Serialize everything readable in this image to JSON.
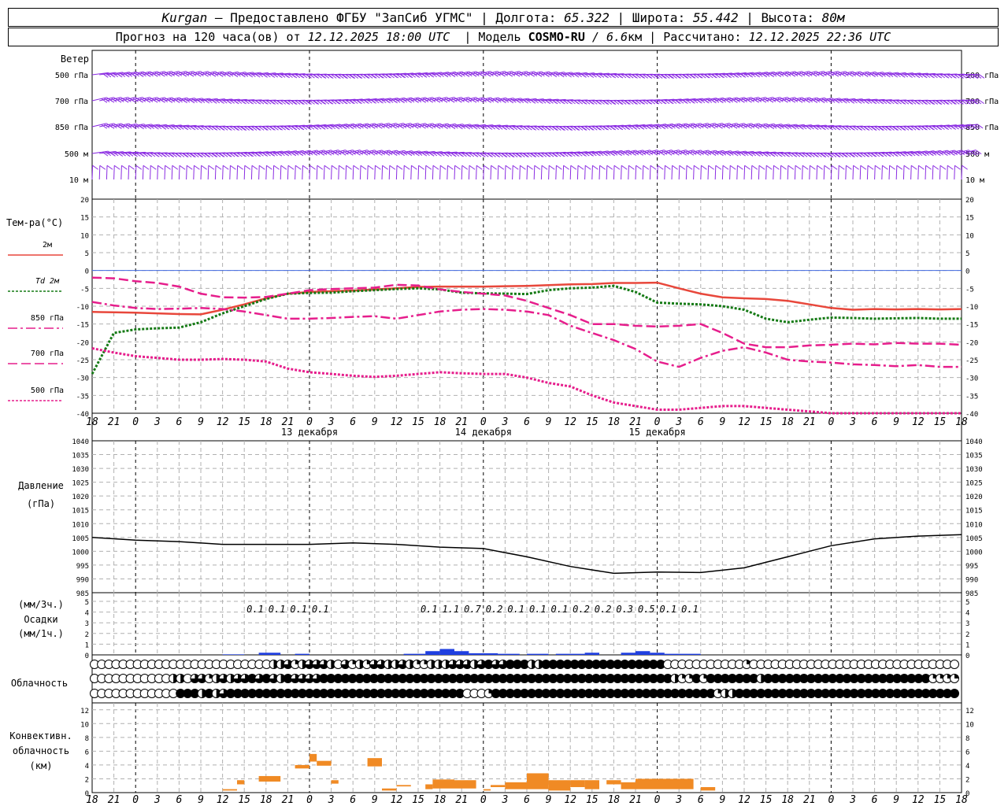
{
  "header": {
    "station": "Kurgan",
    "dash": " — ",
    "provider": "Предоставлено ФГБУ \"ЗапСиб УГМС\"",
    "sep": " | ",
    "lon_label": "Долгота: ",
    "lon": "65.322",
    "lat_label": "Широта: ",
    "lat": "55.442",
    "alt_label": "Высота: ",
    "alt": "80м",
    "forecast_pre": "Прогноз на 120 часа(ов) от ",
    "forecast_time": "12.12.2025 18:00 UTC",
    "model_label": "  | Модель ",
    "model": "COSMO-RU",
    "model_res": " / 6.6",
    "model_res_unit": "км",
    "calc_label": " | Рассчитано: ",
    "calc_time": "12.12.2025 22:36 UTC"
  },
  "colors": {
    "t2m": "#e8473b",
    "td2m": "#157a15",
    "t850": "#e61e8c",
    "t700": "#e61e8c",
    "t500": "#e61e8c",
    "wind": "#8a2be2",
    "precip": "#1f3fe0",
    "convective": "#f08a24",
    "pressure": "#000000",
    "zero_line": "#4169e1",
    "grid": "#b0b0b0"
  },
  "chart_data": [
    {
      "type": "line",
      "panel": "wind",
      "title": "Ветер",
      "levels": [
        "500 гПа",
        "700 гПа",
        "850 гПа",
        "500 м",
        "10  м"
      ],
      "legend": "wind barbs at each level, every 3 hours"
    },
    {
      "type": "line",
      "panel": "temperature",
      "title": "Тем-ра(°C)",
      "yticks": [
        20,
        15,
        10,
        5,
        0,
        -5,
        -10,
        -15,
        -20,
        -25,
        -30,
        -35,
        -40
      ],
      "ylim": [
        -40,
        20
      ],
      "x_hours": [
        0,
        3,
        6,
        9,
        12,
        15,
        18,
        21,
        24,
        27,
        30,
        33,
        36,
        39,
        42,
        45,
        48,
        51,
        54,
        57,
        60,
        63,
        66,
        69,
        72,
        75,
        78,
        81,
        84,
        87,
        90,
        93,
        96,
        99,
        102,
        105,
        108,
        111,
        114,
        117,
        120
      ],
      "x_tick_labels": [
        "18",
        "21",
        "0",
        "3",
        "6",
        "9",
        "12",
        "15",
        "18",
        "21",
        "0",
        "3",
        "6",
        "9",
        "12",
        "15",
        "18",
        "21",
        "0",
        "3",
        "6",
        "9",
        "12",
        "15",
        "18",
        "21",
        "0",
        "3",
        "6",
        "9",
        "12",
        "15",
        "18",
        "21",
        "0",
        "3",
        "6",
        "9",
        "12",
        "15",
        "18",
        "21",
        "0"
      ],
      "day_labels": [
        "13 декабря",
        "14 декабря",
        "15 декабря"
      ],
      "series": [
        {
          "name": "2м",
          "style": "solid",
          "values": [
            -11.6,
            -11.7,
            -11.8,
            -12.0,
            -12.2,
            -12.3,
            -11.0,
            -9.5,
            -7.8,
            -6.5,
            -6.0,
            -5.8,
            -5.6,
            -5.3,
            -5.0,
            -4.6,
            -4.5,
            -4.5,
            -4.5,
            -4.4,
            -4.3,
            -4.1,
            -3.9,
            -3.8,
            -3.5,
            -3.5,
            -3.4,
            -5.0,
            -6.5,
            -7.5,
            -7.8,
            -8.0,
            -8.5,
            -9.5,
            -10.5,
            -11.0,
            -10.8,
            -10.9,
            -10.8,
            -10.9,
            -10.8
          ]
        },
        {
          "name": "Td 2м",
          "style": "dotted",
          "values": [
            -29,
            -17.5,
            -16.5,
            -16.2,
            -16.0,
            -14.5,
            -12.0,
            -10.0,
            -8.0,
            -6.5,
            -6.3,
            -6.2,
            -5.8,
            -5.5,
            -5.2,
            -5.0,
            -5.3,
            -6.2,
            -6.4,
            -6.5,
            -6.6,
            -5.5,
            -5.0,
            -4.8,
            -4.3,
            -6.0,
            -9.0,
            -9.3,
            -9.5,
            -10.0,
            -11.0,
            -13.5,
            -14.5,
            -13.8,
            -13.2,
            -13.3,
            -13.5,
            -13.4,
            -13.3,
            -13.5,
            -13.5
          ]
        },
        {
          "name": "850 гПа",
          "style": "dashdot",
          "values": [
            -8.8,
            -9.8,
            -10.5,
            -10.8,
            -10.7,
            -10.5,
            -10.8,
            -11.5,
            -12.5,
            -13.5,
            -13.5,
            -13.3,
            -13.0,
            -12.8,
            -13.5,
            -12.5,
            -11.5,
            -11.0,
            -10.8,
            -11.0,
            -11.5,
            -12.5,
            -15.5,
            -17.5,
            -19.5,
            -22.0,
            -25.5,
            -27.0,
            -24.5,
            -22.5,
            -21.5,
            -23.0,
            -25.0,
            -25.5,
            -25.8,
            -26.3,
            -26.5,
            -26.8,
            -26.5,
            -27.0,
            -27.0
          ]
        },
        {
          "name": "700 гПа",
          "style": "dashed",
          "values": [
            -2.0,
            -2.2,
            -3.0,
            -3.5,
            -4.5,
            -6.5,
            -7.5,
            -7.6,
            -7.4,
            -6.5,
            -5.5,
            -5.2,
            -5.0,
            -4.8,
            -4.0,
            -4.2,
            -5.3,
            -6.0,
            -6.5,
            -7.0,
            -8.5,
            -10.5,
            -12.5,
            -15.0,
            -15.0,
            -15.5,
            -15.7,
            -15.5,
            -15.0,
            -17.5,
            -20.5,
            -21.5,
            -21.5,
            -21.0,
            -20.8,
            -20.5,
            -20.7,
            -20.3,
            -20.5,
            -20.5,
            -20.8
          ]
        },
        {
          "name": "500 гПа",
          "style": "dotted",
          "values": [
            -21.8,
            -23.0,
            -24.0,
            -24.5,
            -25.0,
            -25.0,
            -24.8,
            -25.0,
            -25.5,
            -27.5,
            -28.5,
            -29.0,
            -29.5,
            -29.8,
            -29.5,
            -29.0,
            -28.5,
            -28.8,
            -29.0,
            -29.0,
            -30.0,
            -31.5,
            -32.5,
            -35.0,
            -37.0,
            -38.0,
            -39.0,
            -39.0,
            -38.5,
            -38.0,
            -38.0,
            -38.5,
            -39.0,
            -39.5,
            -40.2,
            -41.0,
            -42.0,
            -43.0,
            -44.0,
            -45.0,
            -46.0
          ]
        }
      ]
    },
    {
      "type": "line",
      "panel": "pressure",
      "title": "Давление",
      "unit": "(гПа)",
      "yticks": [
        1040,
        1035,
        1030,
        1025,
        1020,
        1015,
        1010,
        1005,
        1000,
        995,
        990,
        985
      ],
      "ylim": [
        985,
        1040
      ],
      "x_hours": [
        0,
        6,
        12,
        18,
        24,
        30,
        36,
        42,
        48,
        54,
        60,
        66,
        72,
        78,
        84,
        90,
        96,
        102,
        108,
        114,
        120
      ],
      "values": [
        1005,
        1004,
        1003.5,
        1002.5,
        1002.5,
        1002.5,
        1003,
        1002.5,
        1001.5,
        1001,
        998,
        994.5,
        992,
        992.5,
        992.3,
        994,
        998,
        1002,
        1004.5,
        1005.5,
        1006
      ]
    },
    {
      "type": "bar",
      "panel": "precipitation",
      "title": "(мм/3ч.)",
      "title2": "Осадки",
      "title3": "(мм/1ч.)",
      "yticks": [
        5,
        4,
        3,
        2,
        1,
        0
      ],
      "ylim": [
        0,
        5
      ],
      "labels_3h": [
        {
          "hour": 21,
          "value": "0.1"
        },
        {
          "hour": 24,
          "value": "0.1"
        },
        {
          "hour": 27,
          "value": "0.1"
        },
        {
          "hour": 30,
          "value": "0.1"
        },
        {
          "hour": 45,
          "value": "0.1"
        },
        {
          "hour": 48,
          "value": "1.1"
        },
        {
          "hour": 51,
          "value": "0.7"
        },
        {
          "hour": 54,
          "value": "0.2"
        },
        {
          "hour": 57,
          "value": "0.1"
        },
        {
          "hour": 60,
          "value": "0.1"
        },
        {
          "hour": 63,
          "value": "0.1"
        },
        {
          "hour": 66,
          "value": "0.2"
        },
        {
          "hour": 69,
          "value": "0.2"
        },
        {
          "hour": 72,
          "value": "0.3"
        },
        {
          "hour": 75,
          "value": "0.5"
        },
        {
          "hour": 78,
          "value": "0.1"
        },
        {
          "hour": 81,
          "value": "0.1"
        }
      ],
      "hourly": [
        {
          "from": 18,
          "to": 21,
          "value": 0.05
        },
        {
          "from": 23,
          "to": 26,
          "value": 0.2
        },
        {
          "from": 28,
          "to": 30,
          "value": 0.1
        },
        {
          "from": 43,
          "to": 46,
          "value": 0.1
        },
        {
          "from": 46,
          "to": 48,
          "value": 0.35
        },
        {
          "from": 48,
          "to": 50,
          "value": 0.55
        },
        {
          "from": 50,
          "to": 52,
          "value": 0.35
        },
        {
          "from": 52,
          "to": 56,
          "value": 0.15
        },
        {
          "from": 56,
          "to": 59,
          "value": 0.1
        },
        {
          "from": 60,
          "to": 63,
          "value": 0.1
        },
        {
          "from": 64,
          "to": 68,
          "value": 0.1
        },
        {
          "from": 68,
          "to": 70,
          "value": 0.2
        },
        {
          "from": 73,
          "to": 75,
          "value": 0.2
        },
        {
          "from": 75,
          "to": 77,
          "value": 0.35
        },
        {
          "from": 77,
          "to": 79,
          "value": 0.2
        },
        {
          "from": 79,
          "to": 81,
          "value": 0.1
        },
        {
          "from": 81,
          "to": 84,
          "value": 0.1
        }
      ]
    },
    {
      "type": "table",
      "panel": "cloudiness",
      "title": "Облачность",
      "rows": [
        "high",
        "middle",
        "low"
      ],
      "note": "cloud cover circles 0..4 (empty to full) each hour",
      "high": [
        0,
        0,
        0,
        0,
        0,
        0,
        0,
        0,
        0,
        0,
        0,
        0,
        0,
        0,
        0,
        0,
        0,
        0,
        0,
        0,
        0,
        0,
        0,
        0,
        0,
        2,
        2,
        3,
        1,
        2,
        3,
        3,
        3,
        2,
        0,
        3,
        1,
        2,
        1,
        3,
        3,
        2,
        2,
        3,
        2,
        1,
        1,
        2,
        2,
        2,
        3,
        3,
        3,
        2,
        3,
        4,
        3,
        3,
        4,
        4,
        4,
        2,
        2,
        4,
        4,
        4,
        4,
        4,
        4,
        4,
        4,
        4,
        4,
        4,
        4,
        4,
        4,
        4,
        4,
        4,
        0,
        0,
        0,
        0,
        0,
        0,
        0,
        0,
        0,
        0,
        0,
        1,
        0,
        0,
        0,
        0,
        0,
        0,
        0,
        0,
        0,
        0,
        0,
        0,
        0,
        0,
        0,
        0,
        0,
        0,
        0,
        0,
        0,
        0,
        0,
        0,
        0,
        0,
        0,
        0,
        0
      ],
      "middle": [
        0,
        0,
        0,
        0,
        0,
        0,
        0,
        0,
        0,
        0,
        0,
        2,
        2,
        0,
        3,
        3,
        1,
        2,
        3,
        2,
        3,
        3,
        4,
        3,
        4,
        3,
        2,
        4,
        3,
        3,
        3,
        3,
        4,
        4,
        4,
        4,
        4,
        4,
        4,
        4,
        4,
        4,
        4,
        4,
        4,
        4,
        4,
        4,
        4,
        4,
        4,
        4,
        4,
        4,
        4,
        4,
        4,
        4,
        4,
        4,
        4,
        4,
        4,
        4,
        4,
        4,
        4,
        4,
        4,
        4,
        4,
        4,
        4,
        4,
        4,
        4,
        4,
        4,
        4,
        4,
        4,
        2,
        1,
        1,
        4,
        1,
        4,
        4,
        4,
        4,
        4,
        4,
        4,
        2,
        4,
        4,
        4,
        4,
        4,
        4,
        4,
        4,
        4,
        4,
        4,
        4,
        4,
        4,
        4,
        4,
        4,
        4,
        4,
        4,
        4,
        4,
        4,
        1,
        1,
        1,
        1,
        1
      ],
      "low": [
        0,
        0,
        0,
        0,
        0,
        0,
        0,
        0,
        0,
        0,
        0,
        0,
        4,
        4,
        4,
        2,
        4,
        2,
        3,
        4,
        4,
        4,
        4,
        4,
        4,
        4,
        4,
        4,
        4,
        4,
        4,
        4,
        4,
        4,
        4,
        4,
        4,
        4,
        4,
        4,
        4,
        4,
        4,
        4,
        4,
        4,
        4,
        4,
        4,
        4,
        4,
        4,
        0,
        0,
        0,
        1,
        4,
        4,
        4,
        4,
        4,
        4,
        4,
        4,
        4,
        4,
        4,
        4,
        4,
        4,
        4,
        4,
        4,
        4,
        4,
        4,
        4,
        4,
        4,
        4,
        4,
        4,
        4,
        4,
        4,
        4,
        4,
        1,
        2,
        2,
        4,
        4,
        4,
        4,
        4,
        4,
        4,
        4,
        4,
        4,
        4,
        4,
        4,
        4,
        4,
        4,
        4,
        4,
        4,
        4,
        4,
        4,
        4,
        4,
        4,
        4,
        4,
        4,
        4,
        4,
        4,
        4
      ]
    },
    {
      "type": "bar",
      "panel": "convective",
      "title": "Конвективн.",
      "title2": "облачность",
      "title3": "(км)",
      "yticks": [
        12,
        10,
        8,
        6,
        4,
        2,
        0
      ],
      "ylim": [
        0,
        13
      ],
      "layers": [
        {
          "from": 18,
          "to": 20,
          "bottom": 0.3,
          "top": 0.5
        },
        {
          "from": 20,
          "to": 21,
          "bottom": 1.2,
          "top": 1.8
        },
        {
          "from": 23,
          "to": 26,
          "bottom": 1.6,
          "top": 2.4
        },
        {
          "from": 28,
          "to": 30,
          "bottom": 3.5,
          "top": 4.0
        },
        {
          "from": 30,
          "to": 31,
          "bottom": 4.5,
          "top": 5.6
        },
        {
          "from": 31,
          "to": 33,
          "bottom": 3.9,
          "top": 4.6
        },
        {
          "from": 33,
          "to": 34,
          "bottom": 1.3,
          "top": 1.8
        },
        {
          "from": 38,
          "to": 40,
          "bottom": 3.8,
          "top": 5.0
        },
        {
          "from": 40,
          "to": 42,
          "bottom": 0.3,
          "top": 0.6
        },
        {
          "from": 42,
          "to": 44,
          "bottom": 0.9,
          "top": 1.1
        },
        {
          "from": 46,
          "to": 47,
          "bottom": 0.5,
          "top": 1.2
        },
        {
          "from": 47,
          "to": 50,
          "bottom": 0.6,
          "top": 1.9
        },
        {
          "from": 50,
          "to": 53,
          "bottom": 0.6,
          "top": 1.8
        },
        {
          "from": 54,
          "to": 55,
          "bottom": 0.3,
          "top": 0.5
        },
        {
          "from": 55,
          "to": 57,
          "bottom": 0.8,
          "top": 1.1
        },
        {
          "from": 57,
          "to": 60,
          "bottom": 0.5,
          "top": 1.5
        },
        {
          "from": 60,
          "to": 63,
          "bottom": 0.5,
          "top": 2.8
        },
        {
          "from": 63,
          "to": 66,
          "bottom": 0.3,
          "top": 1.8
        },
        {
          "from": 66,
          "to": 68,
          "bottom": 0.8,
          "top": 1.8
        },
        {
          "from": 68,
          "to": 70,
          "bottom": 0.5,
          "top": 1.8
        },
        {
          "from": 71,
          "to": 73,
          "bottom": 1.2,
          "top": 1.8
        },
        {
          "from": 73,
          "to": 75,
          "bottom": 0.5,
          "top": 1.5
        },
        {
          "from": 75,
          "to": 80,
          "bottom": 0.5,
          "top": 2.0
        },
        {
          "from": 80,
          "to": 83,
          "bottom": 0.5,
          "top": 2.0
        },
        {
          "from": 84,
          "to": 86,
          "bottom": 0.3,
          "top": 0.8
        }
      ]
    }
  ]
}
